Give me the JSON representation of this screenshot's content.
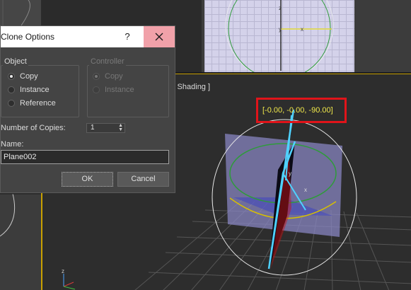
{
  "dialog": {
    "title": "Clone Options",
    "help_label": "?",
    "close_label": "✕",
    "object_group": {
      "label": "Object",
      "options": [
        {
          "label": "Copy",
          "checked": true
        },
        {
          "label": "Instance",
          "checked": false
        },
        {
          "label": "Reference",
          "checked": false
        }
      ]
    },
    "controller_group": {
      "label": "Controller",
      "options": [
        {
          "label": "Copy",
          "checked": true
        },
        {
          "label": "Instance",
          "checked": false
        }
      ]
    },
    "copies_label": "Number of Copies:",
    "copies_value": "1",
    "name_label": "Name:",
    "name_value": "Plane002",
    "ok_label": "OK",
    "cancel_label": "Cancel"
  },
  "viewport": {
    "shading_label": "lt Shading ]",
    "coordinate_readout": "[-0.00, -0.00, -90.00]",
    "axis_labels": {
      "x": "x",
      "y": "y",
      "z": "z"
    }
  },
  "colors": {
    "highlight_box": "#e0141a",
    "readout_text": "#f0e84a",
    "selection_outline": "#4fd2ff",
    "grid_plane": "#8b88c6",
    "gizmo_green": "#2e9b3a",
    "gizmo_yellow": "#d8c000"
  }
}
